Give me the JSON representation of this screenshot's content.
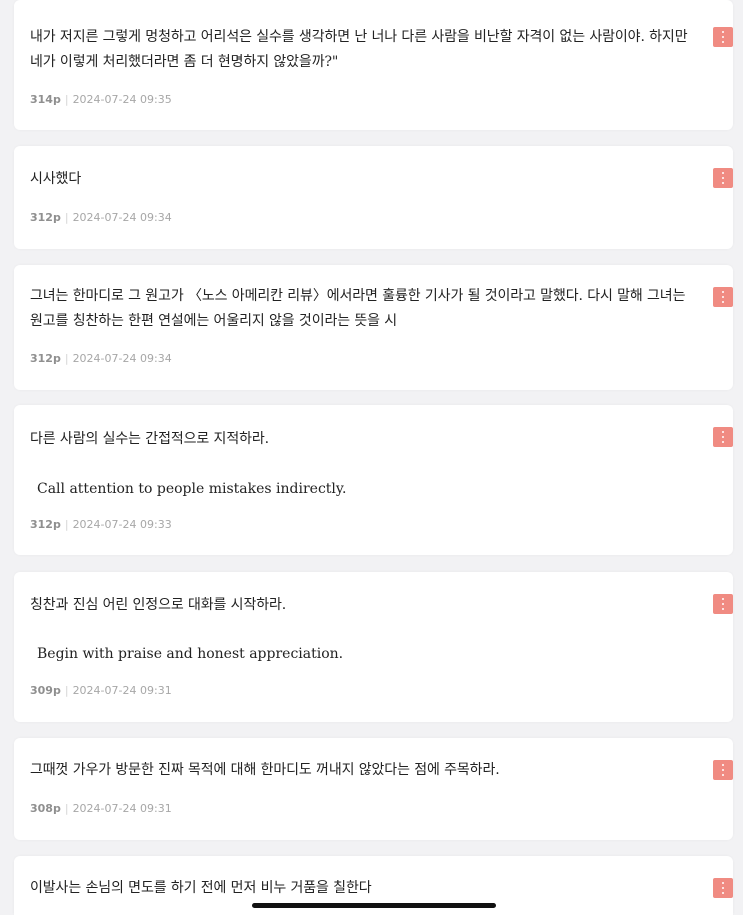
{
  "notes": [
    {
      "text": "내가 저지른 그렇게 멍청하고 어리석은 실수를 생각하면 난 너나 다른 사람을 비난할 자격이 없는 사람이야. 하지만 네가 이렇게 처리했더라면 좀 더 현명하지 않았을까?\"",
      "quote": "",
      "page": "314p",
      "date": "2024-07-24 09:35"
    },
    {
      "text": "시사했다",
      "quote": "",
      "page": "312p",
      "date": "2024-07-24 09:34"
    },
    {
      "text": "그녀는 한마디로 그 원고가 〈노스 아메리칸 리뷰〉에서라면 훌륭한 기사가 될 것이라고 말했다. 다시 말해 그녀는 원고를 칭찬하는 한편 연설에는 어울리지 않을 것이라는 뜻을 시",
      "quote": "",
      "page": "312p",
      "date": "2024-07-24 09:34"
    },
    {
      "text": "다른 사람의 실수는 간접적으로 지적하라.",
      "quote": "Call attention to people mistakes indirectly.",
      "page": "312p",
      "date": "2024-07-24 09:33"
    },
    {
      "text": "칭찬과 진심 어린 인정으로 대화를 시작하라.",
      "quote": "Begin with praise and honest appreciation.",
      "page": "309p",
      "date": "2024-07-24 09:31"
    },
    {
      "text": "그때껏 가우가 방문한 진짜 목적에 대해 한마디도 꺼내지 않았다는 점에 주목하라.",
      "quote": "",
      "page": "308p",
      "date": "2024-07-24 09:31"
    },
    {
      "text": "이발사는 손님의 면도를 하기 전에 먼저 비누 거품을 칠한다",
      "quote": "",
      "page": "",
      "date": ""
    }
  ],
  "colors": {
    "menu_button": "#f08b82",
    "background": "#f2f2f4",
    "card": "#ffffff"
  },
  "icons": {
    "menu": "more-vertical-icon"
  }
}
